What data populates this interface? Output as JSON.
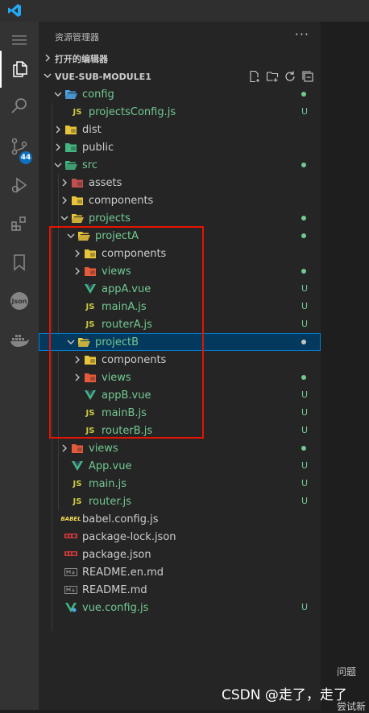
{
  "explorer": {
    "title": "资源管理器",
    "more": "···",
    "open_editors": "打开的编辑器",
    "project": "VUE-SUB-MODULE1"
  },
  "activity": {
    "scm_badge": "44"
  },
  "tree": [
    {
      "name": "config",
      "kind": "folder",
      "color": "#4da7e8",
      "status": "dot",
      "level": 1
    },
    {
      "name": "projectsConfig.js",
      "kind": "js",
      "status": "U",
      "level": 2
    },
    {
      "name": "dist",
      "kind": "folder",
      "color": "#e8c43a",
      "status": "",
      "level": 1
    },
    {
      "name": "public",
      "kind": "folder",
      "color": "#43b581",
      "status": "",
      "level": 1
    },
    {
      "name": "src",
      "kind": "folder",
      "color": "#43b581",
      "status": "dot",
      "level": 1
    },
    {
      "name": "assets",
      "kind": "folder",
      "color": "#c0504d",
      "status": "",
      "level": 2
    },
    {
      "name": "components",
      "kind": "folder",
      "color": "#e8c43a",
      "status": "",
      "level": 2
    },
    {
      "name": "projects",
      "kind": "folder",
      "color": "#e8c43a",
      "status": "dot",
      "level": 2
    },
    {
      "name": "projectA",
      "kind": "folder",
      "color": "#e8c43a",
      "status": "dot",
      "level": 3
    },
    {
      "name": "components",
      "kind": "folder",
      "color": "#e8c43a",
      "status": "",
      "level": 4
    },
    {
      "name": "views",
      "kind": "folder",
      "color": "#e55a3a",
      "status": "dot",
      "level": 4
    },
    {
      "name": "appA.vue",
      "kind": "vue",
      "status": "U",
      "level": 4
    },
    {
      "name": "mainA.js",
      "kind": "js",
      "status": "U",
      "level": 4
    },
    {
      "name": "routerA.js",
      "kind": "js",
      "status": "U",
      "level": 4
    },
    {
      "name": "projectB",
      "kind": "folder",
      "color": "#e8c43a",
      "status": "dot",
      "level": 3
    },
    {
      "name": "components",
      "kind": "folder",
      "color": "#e8c43a",
      "status": "",
      "level": 4
    },
    {
      "name": "views",
      "kind": "folder",
      "color": "#e55a3a",
      "status": "dot",
      "level": 4
    },
    {
      "name": "appB.vue",
      "kind": "vue",
      "status": "U",
      "level": 4
    },
    {
      "name": "mainB.js",
      "kind": "js",
      "status": "U",
      "level": 4
    },
    {
      "name": "routerB.js",
      "kind": "js",
      "status": "U",
      "level": 4
    },
    {
      "name": "views",
      "kind": "folder",
      "color": "#e55a3a",
      "status": "dot",
      "level": 2
    },
    {
      "name": "App.vue",
      "kind": "vue",
      "status": "U",
      "level": 2
    },
    {
      "name": "main.js",
      "kind": "js",
      "status": "U",
      "level": 2
    },
    {
      "name": "router.js",
      "kind": "js",
      "status": "U",
      "level": 2
    },
    {
      "name": "babel.config.js",
      "kind": "babel",
      "status": "",
      "level": 1
    },
    {
      "name": "package-lock.json",
      "kind": "npm",
      "status": "",
      "level": 1
    },
    {
      "name": "package.json",
      "kind": "npm",
      "status": "",
      "level": 1
    },
    {
      "name": "README.en.md",
      "kind": "md",
      "status": "",
      "level": 1
    },
    {
      "name": "README.md",
      "kind": "md",
      "status": "",
      "level": 1
    },
    {
      "name": "vue.config.js",
      "kind": "vueconfig",
      "status": "U",
      "level": 1
    }
  ],
  "panel": {
    "problems_tab": "问题"
  },
  "watermark": {
    "text": "CSDN @走了，走了",
    "sub": "尝试新"
  },
  "colors": {
    "untracked": "#73c991",
    "selected_bg": "#04395e",
    "highlight_box": "#e51400"
  }
}
